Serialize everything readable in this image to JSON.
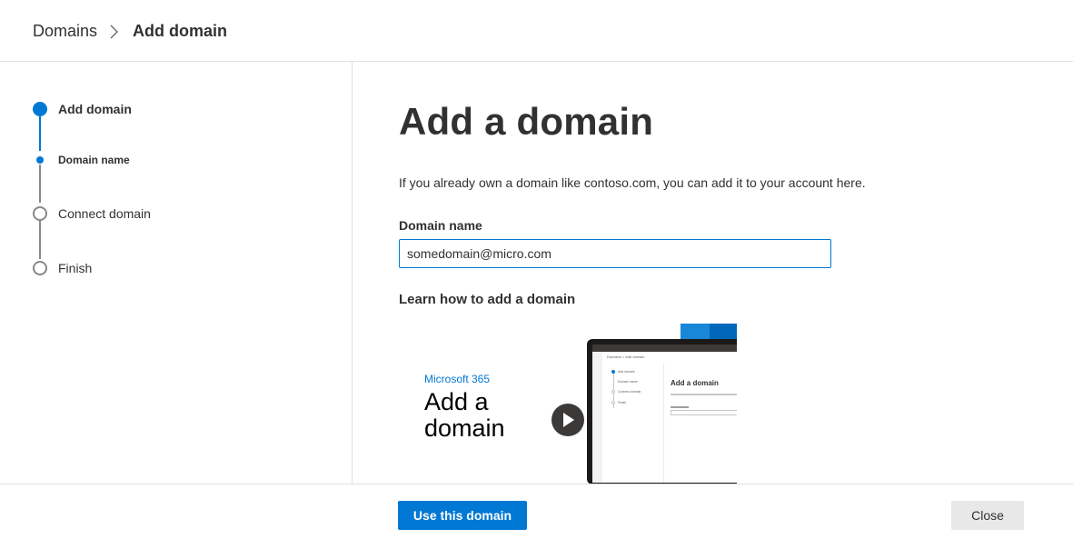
{
  "breadcrumb": {
    "root": "Domains",
    "current": "Add domain",
    "separator_icon": "chevron-right-icon"
  },
  "wizard": {
    "steps": [
      {
        "label": "Add domain",
        "state": "current"
      },
      {
        "label": "Domain name",
        "state": "current-substep"
      },
      {
        "label": "Connect domain",
        "state": "pending"
      },
      {
        "label": "Finish",
        "state": "pending"
      }
    ]
  },
  "main": {
    "title": "Add a domain",
    "intro": "If you already own a domain like contoso.com, you can add it to your account here.",
    "field_label": "Domain name",
    "field_value": "somedomain@micro.com",
    "learn_title": "Learn how to add a domain"
  },
  "video": {
    "brand": "Microsoft 365",
    "title": "Add a domain",
    "play_icon": "play-icon"
  },
  "footer": {
    "primary": "Use this domain",
    "secondary": "Close"
  },
  "colors": {
    "accent": "#0078d4",
    "text": "#323130",
    "border": "#e1dfdd",
    "step_pending": "#8a8886"
  }
}
